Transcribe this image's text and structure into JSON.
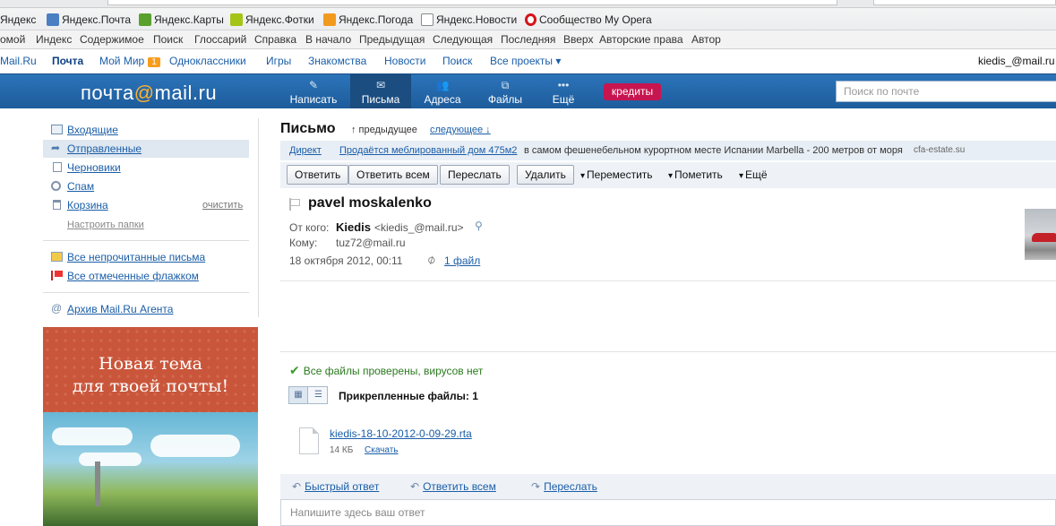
{
  "bookmarks": [
    {
      "label": "Яндекс",
      "icon": "yandex-icon",
      "color": "#d32f2f"
    },
    {
      "label": "Яндекс.Почта",
      "icon": "mail-envelope-icon",
      "color": "#4a7fc1"
    },
    {
      "label": "Яндекс.Карты",
      "icon": "map-icon",
      "color": "#5aa02c"
    },
    {
      "label": "Яндекс.Фотки",
      "icon": "photo-icon",
      "color": "#a4c416"
    },
    {
      "label": "Яндекс.Погода",
      "icon": "weather-icon",
      "color": "#f29a1e"
    },
    {
      "label": "Яндекс.Новости",
      "icon": "news-icon",
      "color": "#8a8a8a"
    },
    {
      "label": "Сообщество My Opera",
      "icon": "opera-icon",
      "color": "#d4141a"
    }
  ],
  "browser_menu": [
    "омой",
    "Индекс",
    "Содержимое",
    "Поиск",
    "Глоссарий",
    "Справка",
    "В начало",
    "Предыдущая",
    "Следующая",
    "Последняя",
    "Вверх",
    "Авторские права",
    "Автор"
  ],
  "portal": {
    "items": [
      "Mail.Ru",
      "Почта",
      "Мой Мир",
      "Одноклассники",
      "Игры",
      "Знакомства",
      "Новости",
      "Поиск",
      "Все проекты ▾"
    ],
    "mymir_badge": "1",
    "user": "kiedis_@mail.ru"
  },
  "header": {
    "logo_pre": "почта",
    "logo_at": "@",
    "logo_post": "mail.ru",
    "buttons": [
      {
        "label": "Написать",
        "icon": "pencil-icon"
      },
      {
        "label": "Письма",
        "icon": "envelope-icon"
      },
      {
        "label": "Адреса",
        "icon": "contacts-icon"
      },
      {
        "label": "Файлы",
        "icon": "files-icon"
      },
      {
        "label": "Ещё",
        "icon": "more-dots-icon"
      }
    ],
    "credits": "кредиты",
    "search_placeholder": "Поиск по почте"
  },
  "sidebar": {
    "folders": [
      {
        "label": "Входящие",
        "icon": "inbox-icon"
      },
      {
        "label": "Отправленные",
        "icon": "sent-icon"
      },
      {
        "label": "Черновики",
        "icon": "drafts-icon"
      },
      {
        "label": "Спам",
        "icon": "spam-icon"
      },
      {
        "label": "Корзина",
        "icon": "trash-icon"
      }
    ],
    "clean": "очистить",
    "setup_folders": "Настроить папки",
    "filters": [
      {
        "label": "Все непрочитанные письма",
        "icon": "unread-icon"
      },
      {
        "label": "Все отмеченные флажком",
        "icon": "flag-icon"
      }
    ],
    "agent_archive": "Архив Mail.Ru Агента",
    "promo": {
      "line1": "Новая тема",
      "line2": "для твоей почты!"
    }
  },
  "message": {
    "section_title": "Письмо",
    "prev": "↑ предыдущее",
    "next": "следующее ↓",
    "ad": {
      "label": "Директ",
      "link": "Продаётся меблированный дом 475м2",
      "text": "в самом фешенебельном курортном месте Испании Marbella - 200 метров от моря",
      "domain": "cfa-estate.su"
    },
    "toolbar": {
      "reply": "Ответить",
      "reply_all": "Ответить всем",
      "forward": "Переслать",
      "delete": "Удалить",
      "move": "Переместить",
      "mark": "Пометить",
      "more": "Ещё"
    },
    "subject": "pavel moskalenko",
    "from_label": "От кого:",
    "from_name": "Kiedis",
    "from_address": "<kiedis_@mail.ru>",
    "to_label": "Кому:",
    "to_address": "tuz72@mail.ru",
    "date": "18 октября 2012, 00:11",
    "files_link": "1 файл",
    "virus_check": "Все файлы проверены, вирусов нет",
    "attachments_title": "Прикрепленные файлы: 1",
    "attachment": {
      "name": "kiedis-18-10-2012-0-09-29.rta",
      "size": "14 КБ",
      "download": "Скачать"
    },
    "quick_actions": {
      "quick_reply": "Быстрый ответ",
      "reply_all": "Ответить всем",
      "forward": "Переслать"
    },
    "reply_placeholder": "Напишите здесь ваш ответ"
  },
  "colors": {
    "header_blue": "#2467a8",
    "accent_link": "#1a5ea8",
    "credits": "#c7154f",
    "badge": "#f89c1c",
    "ok_green": "#3c9a2b"
  }
}
